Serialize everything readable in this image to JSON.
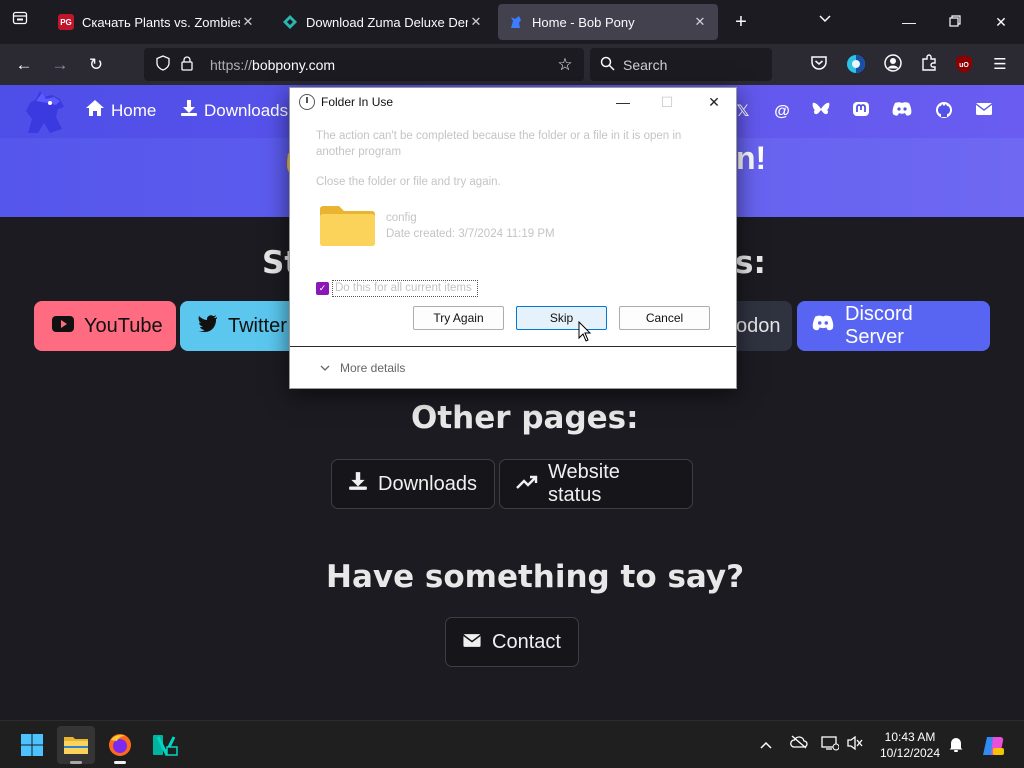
{
  "browser": {
    "tabs": [
      {
        "label": "Скачать Plants vs. Zombies \"M",
        "favicon": "pg-favicon",
        "active": false
      },
      {
        "label": "Download Zuma Deluxe Demo",
        "favicon": "zuma-favicon",
        "active": false
      },
      {
        "label": "Home - Bob Pony",
        "favicon": "bobpony-favicon",
        "active": true
      }
    ],
    "url_protocol": "https://",
    "url_host": "bobpony.com",
    "search_placeholder": "Search",
    "addon_label": "uO"
  },
  "site": {
    "nav": {
      "home_label": "Home",
      "downloads_label": "Downloads"
    },
    "banner_left_glyph": "✋",
    "banner_right_text": "n!",
    "stay_heading_left": "St",
    "stay_heading_right": "s:",
    "socials": [
      {
        "label": "YouTube",
        "color": "#ff6b81"
      },
      {
        "label": "Twitter",
        "color": "#5bc7ef"
      },
      {
        "label": "odon",
        "color": "#2f3340"
      },
      {
        "label": "Discord Server",
        "color": "#5865f2"
      }
    ],
    "other_pages_heading": "Other pages:",
    "other_pages": [
      {
        "label": "Downloads"
      },
      {
        "label": "Website status"
      }
    ],
    "say_heading": "Have something to say?",
    "contact_label": "Contact"
  },
  "dialog": {
    "title": "Folder In Use",
    "message_line1": "The action can't be completed because the folder or a file in it is open in",
    "message_line2": "another program",
    "message2": "Close the folder or file and try again.",
    "item_name": "config",
    "item_date": "Date created: 3/7/2024 11:19 PM",
    "checkbox_label": "Do this for all current items",
    "checkbox_checked": true,
    "buttons": {
      "try_again": "Try Again",
      "skip": "Skip",
      "cancel": "Cancel"
    },
    "more_details": "More details"
  },
  "taskbar": {
    "time": "10:43 AM",
    "date": "10/12/2024"
  },
  "colors": {
    "site_nav": "#5252ea",
    "accent_purple": "#8b17b8",
    "focus_blue": "#0078d4"
  }
}
